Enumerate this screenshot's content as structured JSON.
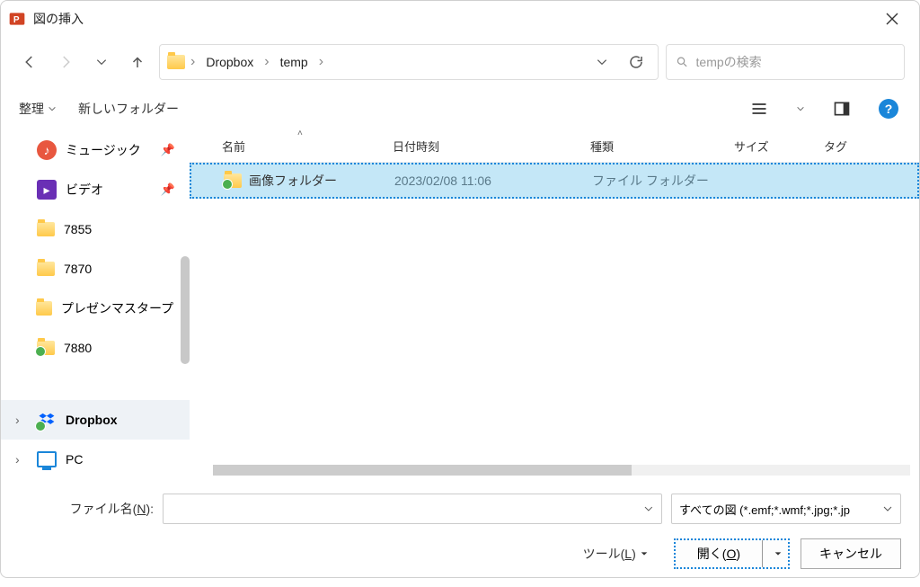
{
  "window": {
    "title": "図の挿入"
  },
  "nav": {
    "breadcrumbs": [
      "Dropbox",
      "temp"
    ]
  },
  "search": {
    "placeholder": "tempの検索"
  },
  "toolbar": {
    "organize": "整理",
    "new_folder": "新しいフォルダー"
  },
  "sidebar": {
    "items": [
      {
        "label": "ミュージック",
        "icon": "music",
        "pinned": true
      },
      {
        "label": "ビデオ",
        "icon": "video",
        "pinned": true
      },
      {
        "label": "7855",
        "icon": "folder",
        "pinned": false
      },
      {
        "label": "7870",
        "icon": "folder",
        "pinned": false
      },
      {
        "label": "プレゼンマスタープロ",
        "icon": "folder",
        "pinned": false
      },
      {
        "label": "7880",
        "icon": "folder-synced",
        "pinned": false
      }
    ],
    "roots": [
      {
        "label": "Dropbox",
        "icon": "dropbox",
        "selected": true
      },
      {
        "label": "PC",
        "icon": "pc",
        "selected": false
      }
    ]
  },
  "columns": {
    "name": "名前",
    "date": "日付時刻",
    "type": "種類",
    "size": "サイズ",
    "tag": "タグ"
  },
  "files": [
    {
      "name": "画像フォルダー",
      "date": "2023/02/08 11:06",
      "type": "ファイル フォルダー",
      "size": "",
      "selected": true
    }
  ],
  "bottom": {
    "filename_label_pre": "ファイル名(",
    "filename_label_key": "N",
    "filename_label_post": "):",
    "filetype": "すべての図 (*.emf;*.wmf;*.jpg;*.jp",
    "tools_pre": "ツール(",
    "tools_key": "L",
    "tools_post": ")",
    "open_pre": "開く(",
    "open_key": "O",
    "open_post": ")",
    "cancel": "キャンセル"
  }
}
